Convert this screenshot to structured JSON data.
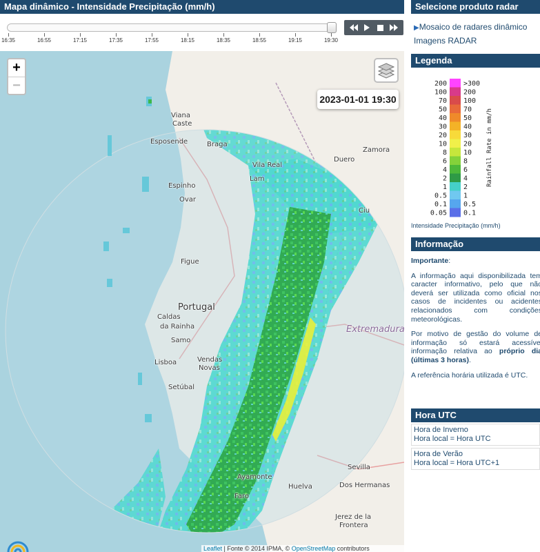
{
  "map_panel": {
    "title": "Mapa dinâmico - Intensidade Precipitação (mm/h)",
    "timeline_ticks": [
      "16:35",
      "16:55",
      "17:15",
      "17:35",
      "17:55",
      "18:15",
      "18:35",
      "18:55",
      "19:15",
      "19:30"
    ],
    "timeline_position": 1.0,
    "playback": {
      "icons": [
        "rewind-icon",
        "play-icon",
        "stop-icon",
        "fast-forward-icon"
      ]
    },
    "zoom_in_label": "+",
    "zoom_out_label": "−",
    "timestamp": "2023-01-01 19:30",
    "attribution": {
      "leaflet": "Leaflet",
      "source": " | Fonte © 2014 IPMA, © ",
      "osm": "OpenStreetMap",
      "contributors": " contributors"
    },
    "map_labels": {
      "viana": "Viana",
      "castelo": "Caste",
      "esposende": "Esposende",
      "braga": "Braga",
      "espinho": "Espinho",
      "ovar": "Ovar",
      "vila_real": "Vila Real",
      "lamego": "Lam",
      "zamora": "Zamora",
      "duero": "Duero",
      "portugal": "Portugal",
      "caldas": "Caldas",
      "rainha": "da Rainha",
      "lisboa": "Lisboa",
      "setubal": "Setúbal",
      "vendas_novas": "Vendas",
      "novas": "Novas",
      "extremadura": "Extremadura",
      "sevilla": "Sevilla",
      "dos_hermanas": "Dos Hermanas",
      "ayamonte": "Ayamonte",
      "faro": "Faro",
      "huelva": "Huelva",
      "jerez": "Jerez de la",
      "frontera": "Frontera",
      "figueira": "Figue",
      "samora": "Samo",
      "ciudad": "Ciu"
    }
  },
  "radar_panel": {
    "header": "Selecione produto radar",
    "links": [
      {
        "label": "Mosaico de radares dinâmico",
        "active": true
      },
      {
        "label": "Imagens RADAR",
        "active": false
      }
    ]
  },
  "legend": {
    "header": "Legenda",
    "left_labels": [
      "200",
      "100",
      "70",
      "50",
      "40",
      "30",
      "20",
      "10",
      "8",
      "6",
      "4",
      "2",
      "1",
      "0.5",
      "0.1",
      "0.05"
    ],
    "right_labels": [
      ">300",
      "200",
      "100",
      "70",
      "50",
      "40",
      "30",
      "20",
      "10",
      "8",
      "6",
      "4",
      "2",
      "1",
      "0.5",
      "0.1"
    ],
    "colors": [
      "#ff44ff",
      "#d83a8a",
      "#d94b4b",
      "#e86a3a",
      "#ef8a2a",
      "#f4b227",
      "#f8da3a",
      "#f0f04a",
      "#c6e63c",
      "#84d23a",
      "#4cb83a",
      "#2e9a46",
      "#45d0c8",
      "#70c8f0",
      "#56a6ee",
      "#5a6fe8"
    ],
    "axis_label": "Rainfall Rate in mm/h",
    "caption": "Intensidade Precipitação (mm/h)"
  },
  "info": {
    "header": "Informação",
    "important_label": "Importante",
    "important_suffix": ":",
    "p1": "A informação aqui disponibilizada tem caracter informativo, pelo que não deverá ser utilizada como oficial nos casos de incidentes ou acidentes relacionados com condições meteorológicas.",
    "p2_prefix": "Por motivo de gestão do volume de informação só estará acessível informação relativa ao ",
    "p2_bold": "próprio dia (últimas 3 horas)",
    "p2_suffix": ".",
    "p3": "A referência horária utilizada é UTC."
  },
  "utc": {
    "header": "Hora UTC",
    "rows": [
      {
        "title": "Hora de Inverno",
        "value": "Hora local = Hora UTC"
      },
      {
        "title": "Hora de Verão",
        "value": "Hora local = Hora UTC+1"
      }
    ]
  }
}
